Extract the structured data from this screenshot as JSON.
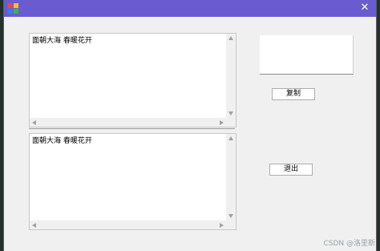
{
  "window": {
    "title_bar_color": "#6a5bd0",
    "app_icon": "app-color-icon",
    "close_glyph": "✕"
  },
  "textarea_top": {
    "text": "面朝大海 春暖花开"
  },
  "textarea_bottom": {
    "text": "面朝大海 春暖花开"
  },
  "buttons": {
    "copy_label": "复制",
    "exit_label": "退出"
  },
  "watermark": "CSDN @洛里斯"
}
